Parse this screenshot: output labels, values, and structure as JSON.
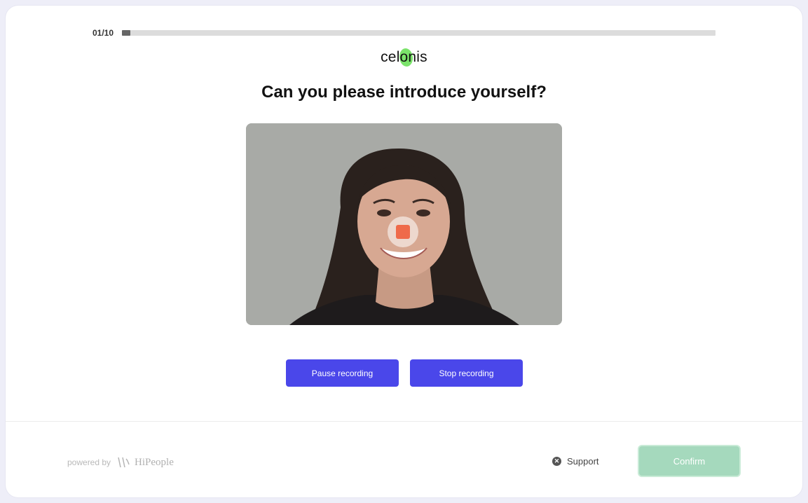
{
  "progress": {
    "label": "01/10",
    "fraction": 0.1
  },
  "logo": {
    "text": "celonis",
    "accent_color": "#7be36b"
  },
  "question": {
    "title": "Can you please introduce yourself?"
  },
  "video": {
    "record_icon": "stop-square-icon",
    "record_color": "#ef6a4a"
  },
  "controls": {
    "pause_label": "Pause recording",
    "stop_label": "Stop recording",
    "color": "#4a47ea"
  },
  "footer": {
    "powered_label": "powered by",
    "brand": "HiPeople",
    "support_label": "Support",
    "support_icon": "close-circle-icon",
    "confirm_label": "Confirm",
    "confirm_color": "#a5d9bd"
  }
}
